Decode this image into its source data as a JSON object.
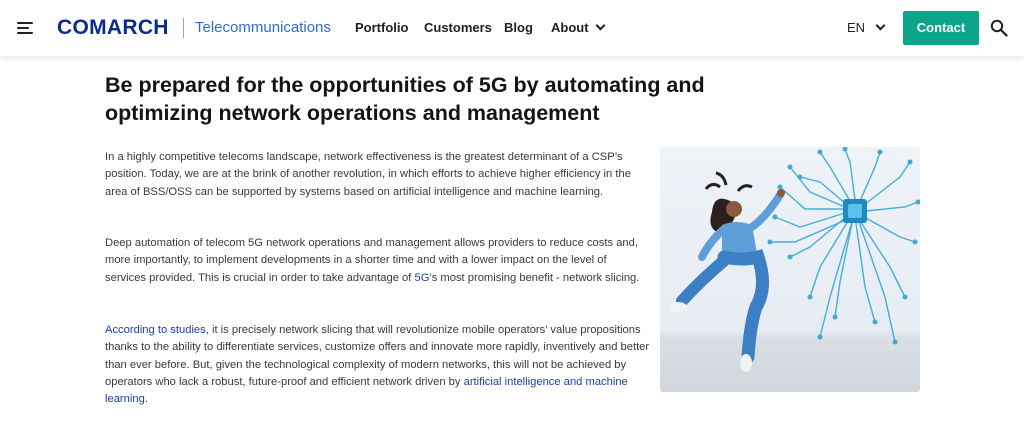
{
  "header": {
    "menu_icon": "hamburger-menu-icon",
    "logo_text": "COMARCH",
    "logo_subtitle": "Telecommunications",
    "nav": [
      "Portfolio",
      "Customers",
      "Blog",
      "About"
    ],
    "language": "EN",
    "contact_label": "Contact",
    "search_icon": "search-icon",
    "accent_color": "#0ba58c",
    "brand_color": "#0a2d8f"
  },
  "article": {
    "title": "Be prepared for the opportunities of 5G by automating and optimizing network operations and management",
    "p1": "In a highly competitive telecoms landscape, network effectiveness is the greatest determinant of a CSP’s position. Today, we are at the brink of another revolution, in which efforts to achieve higher efficiency in the area of BSS/OSS can be supported by systems based on artificial intelligence and machine learning.",
    "p2_a": "Deep automation of telecom 5G network operations and  management allows providers to reduce costs and, more importantly, to implement developments in a shorter time and with a lower impact on the level of services provided. This is crucial in order to take advantage of ",
    "p2_link": "5G",
    "p2_b": "’s most promising benefit - network slicing.",
    "p3_link1": "According to studies",
    "p3_a": ", it is precisely network slicing that will revolutionize mobile operators’ value propositions thanks to the ability to differentiate services, customize offers and innovate more rapidly, inventively and better than ever before. But, given the technological complexity of modern networks, this will not be achieved by operators who lack a robust, future-proof and efficient network driven by ",
    "p3_link2": "artificial intelligence and machine learning",
    "p3_b": "."
  }
}
